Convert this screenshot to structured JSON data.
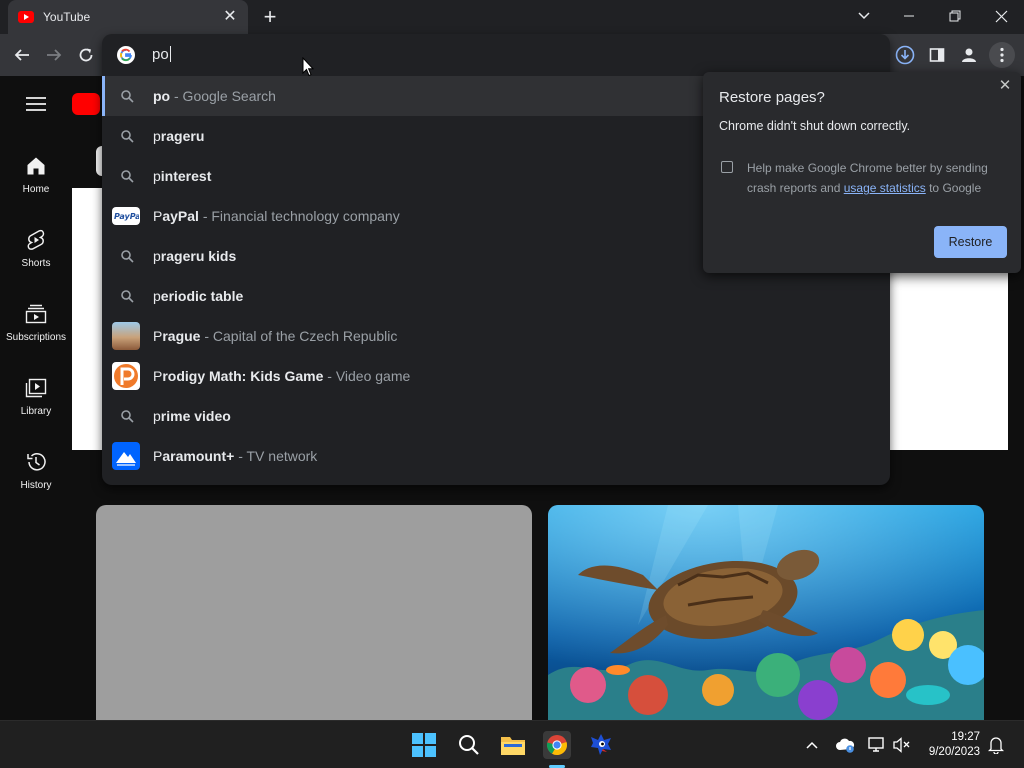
{
  "tab": {
    "title": "YouTube",
    "close": "✕"
  },
  "new_tab": "+",
  "omnibox": {
    "input": "po",
    "suggestions": [
      {
        "bold": "po",
        "rest": "",
        "sub": "- Google Search",
        "icon": "search-icon",
        "selected": true
      },
      {
        "bold": "p",
        "rest": "rageru",
        "sub": "",
        "icon": "search-icon"
      },
      {
        "bold": "p",
        "rest": "interest",
        "sub": "",
        "icon": "search-icon"
      },
      {
        "bold": "P",
        "rest": "ayPal",
        "sub": "- Financial technology company",
        "icon": "paypal-logo"
      },
      {
        "bold": "p",
        "rest": "rageru kids",
        "sub": "",
        "icon": "search-icon"
      },
      {
        "bold": "p",
        "rest": "eriodic table",
        "sub": "",
        "icon": "search-icon"
      },
      {
        "bold": "P",
        "rest": "rague",
        "sub": "- Capital of the Czech Republic",
        "icon": "prague-thumbnail"
      },
      {
        "bold": "P",
        "rest": "rodigy Math: Kids Game",
        "sub": "- Video game",
        "icon": "prodigy-logo"
      },
      {
        "bold": "p",
        "rest": "rime video",
        "sub": "",
        "icon": "search-icon"
      },
      {
        "bold": "P",
        "rest": "aramount+",
        "sub": "- TV network",
        "icon": "paramount-logo"
      }
    ]
  },
  "youtube": {
    "nav": [
      {
        "label": "Home",
        "icon": "home-icon"
      },
      {
        "label": "Shorts",
        "icon": "shorts-icon"
      },
      {
        "label": "Subscriptions",
        "icon": "subscriptions-icon"
      },
      {
        "label": "Library",
        "icon": "library-icon"
      },
      {
        "label": "History",
        "icon": "history-icon"
      }
    ]
  },
  "restore_popup": {
    "title": "Restore pages?",
    "message": "Chrome didn't shut down correctly.",
    "help_prefix": "Help make Google Chrome better by sending crash reports and ",
    "help_link": "usage statistics",
    "help_suffix": " to Google",
    "button": "Restore",
    "close": "✕"
  },
  "taskbar": {
    "time": "19:27",
    "date": "9/20/2023"
  },
  "colors": {
    "accent": "#8ab4f8",
    "youtube_red": "#ff0000",
    "taskbar_indicator": "#60cdff"
  }
}
